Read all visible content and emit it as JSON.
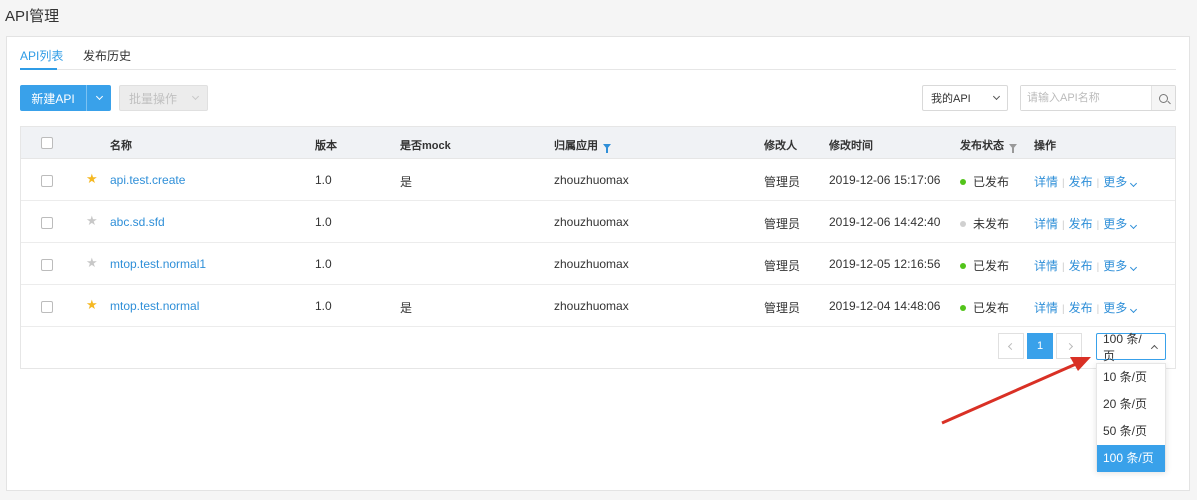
{
  "page_title": "API管理",
  "tabs": [
    {
      "label": "API列表",
      "active": true
    },
    {
      "label": "发布历史",
      "active": false
    }
  ],
  "toolbar": {
    "new_api_label": "新建API",
    "batch_label": "批量操作",
    "filter_select_value": "我的API",
    "search_placeholder": "请输入API名称"
  },
  "table": {
    "headers": {
      "name": "名称",
      "version": "版本",
      "mock": "是否mock",
      "app": "归属应用",
      "modifier": "修改人",
      "modified_time": "修改时间",
      "status": "发布状态",
      "ops": "操作"
    },
    "rows": [
      {
        "starred": true,
        "name": "api.test.create",
        "version": "1.0",
        "mock": "是",
        "app": "zhouzhuomax",
        "modifier": "管理员",
        "time": "2019-12-06 15:17:06",
        "status": "已发布",
        "status_color": "#52c41a"
      },
      {
        "starred": false,
        "name": "abc.sd.sfd",
        "version": "1.0",
        "mock": "",
        "app": "zhouzhuomax",
        "modifier": "管理员",
        "time": "2019-12-06 14:42:40",
        "status": "未发布",
        "status_color": "#d0d0d0"
      },
      {
        "starred": false,
        "name": "mtop.test.normal1",
        "version": "1.0",
        "mock": "",
        "app": "zhouzhuomax",
        "modifier": "管理员",
        "time": "2019-12-05 12:16:56",
        "status": "已发布",
        "status_color": "#52c41a"
      },
      {
        "starred": true,
        "name": "mtop.test.normal",
        "version": "1.0",
        "mock": "是",
        "app": "zhouzhuomax",
        "modifier": "管理员",
        "time": "2019-12-04 14:48:06",
        "status": "已发布",
        "status_color": "#52c41a"
      }
    ],
    "row_ops": {
      "detail": "详情",
      "publish": "发布",
      "more": "更多"
    }
  },
  "pagination": {
    "current_page": "1",
    "page_size_value": "100 条/页",
    "page_size_options": [
      "10 条/页",
      "20 条/页",
      "50 条/页",
      "100 条/页"
    ],
    "selected_option_index": 3
  },
  "colors": {
    "accent": "#39a1ea",
    "link": "#2f8fd8",
    "star_on": "#f5b822",
    "star_off": "#c8c8c8",
    "annotation_arrow": "#d93025"
  },
  "icons": {
    "star": "star-icon",
    "filter": "filter-icon",
    "search": "search-icon",
    "chevron": "chevron-down-icon"
  }
}
